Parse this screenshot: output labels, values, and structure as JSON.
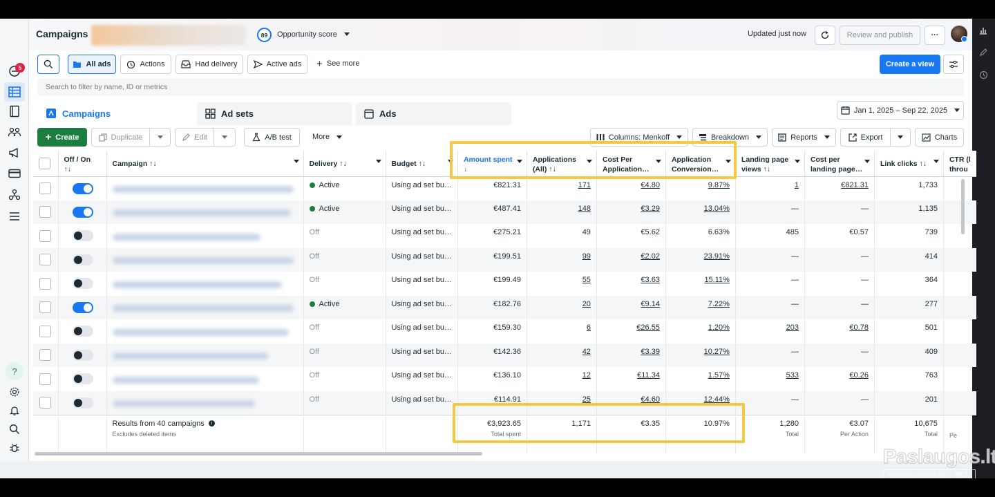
{
  "topbar": {
    "title": "Campaigns",
    "opportunity_score": "89",
    "opportunity_label": "Opportunity score",
    "updated": "Updated just now",
    "review_publish": "Review and publish",
    "more": "···"
  },
  "left_rail": {
    "notification_count": "5"
  },
  "filters": {
    "all_ads": "All ads",
    "actions": "Actions",
    "had_delivery": "Had delivery",
    "active_ads": "Active ads",
    "see_more": "See more",
    "create_view": "Create a view",
    "search_placeholder": "Search to filter by name, ID or metrics"
  },
  "tabs": {
    "campaigns": "Campaigns",
    "ad_sets": "Ad sets",
    "ads": "Ads"
  },
  "date_range": "Jan 1, 2025 – Sep 22, 2025",
  "toolbar": {
    "create": "Create",
    "duplicate": "Duplicate",
    "edit": "Edit",
    "ab_test": "A/B test",
    "more": "More",
    "columns": "Columns: Menkoff",
    "breakdown": "Breakdown",
    "reports": "Reports",
    "export": "Export",
    "charts": "Charts"
  },
  "table": {
    "headers": {
      "offon": [
        "Off / On",
        "↑↓"
      ],
      "campaign": "Campaign ↑↓",
      "delivery": "Delivery ↑↓",
      "budget": "Budget ↑↓",
      "amount_spent": [
        "Amount spent",
        "↓"
      ],
      "applications": [
        "Applications",
        "(All) ↑↓"
      ],
      "cost_per_app": [
        "Cost Per",
        "Application…"
      ],
      "app_conv": [
        "Application",
        "Conversion…"
      ],
      "lp_views": [
        "Landing page",
        "views ↑↓"
      ],
      "cost_lp": [
        "Cost per",
        "landing page…"
      ],
      "link_clicks": "Link clicks ↑↓",
      "ctr": [
        "CTR (l",
        "throu"
      ]
    },
    "rows": [
      {
        "on": true,
        "delivery": "Active",
        "budget": "Using ad set bu…",
        "spent": "€821.31",
        "apps": "171",
        "cpa": "€4.80",
        "conv": "9.87%",
        "lpv": "1",
        "cplp": "€821.31",
        "clicks": "1,733"
      },
      {
        "on": true,
        "delivery": "Active",
        "budget": "Using ad set bu…",
        "spent": "€487.41",
        "apps": "148",
        "cpa": "€3.29",
        "conv": "13.04%",
        "lpv": "—",
        "cplp": "—",
        "clicks": "1,135"
      },
      {
        "on": false,
        "delivery": "Off",
        "budget": "Using ad set bu…",
        "spent": "€275.21",
        "apps": "49",
        "cpa": "€5.62",
        "conv": "6.63%",
        "lpv": "485",
        "cplp": "€0.57",
        "clicks": "739"
      },
      {
        "on": false,
        "delivery": "Off",
        "budget": "Using ad set bu…",
        "spent": "€199.51",
        "apps": "99",
        "cpa": "€2.02",
        "conv": "23.91%",
        "lpv": "—",
        "cplp": "—",
        "clicks": "414"
      },
      {
        "on": false,
        "delivery": "Off",
        "budget": "Using ad set bu…",
        "spent": "€199.49",
        "apps": "55",
        "cpa": "€3.63",
        "conv": "15.11%",
        "lpv": "—",
        "cplp": "—",
        "clicks": "364"
      },
      {
        "on": true,
        "delivery": "Active",
        "budget": "Using ad set bu…",
        "spent": "€182.76",
        "apps": "20",
        "cpa": "€9.14",
        "conv": "7.22%",
        "lpv": "—",
        "cplp": "—",
        "clicks": "277"
      },
      {
        "on": false,
        "delivery": "Off",
        "budget": "Using ad set bu…",
        "spent": "€159.30",
        "apps": "6",
        "cpa": "€26.55",
        "conv": "1.20%",
        "lpv": "203",
        "cplp": "€0.78",
        "clicks": "501"
      },
      {
        "on": false,
        "delivery": "Off",
        "budget": "Using ad set bu…",
        "spent": "€142.36",
        "apps": "42",
        "cpa": "€3.39",
        "conv": "10.27%",
        "lpv": "—",
        "cplp": "—",
        "clicks": "409"
      },
      {
        "on": false,
        "delivery": "Off",
        "budget": "Using ad set bu…",
        "spent": "€136.10",
        "apps": "12",
        "cpa": "€11.34",
        "conv": "1.57%",
        "lpv": "533",
        "cplp": "€0.26",
        "clicks": "763"
      },
      {
        "on": false,
        "delivery": "Off",
        "budget": "Using ad set bu…",
        "spent": "€114.91",
        "apps": "25",
        "cpa": "€4.60",
        "conv": "12.44%",
        "lpv": "—",
        "cplp": "—",
        "clicks": "201"
      }
    ],
    "totals": {
      "results": "Results from 40 campaigns",
      "excludes": "Excludes deleted items",
      "spent": "€3,923.65",
      "spent_sub": "Total spent",
      "apps": "1,171",
      "cpa": "€3.35",
      "conv": "10.97%",
      "lpv": "1,280",
      "lpv_sub": "Total",
      "cplp": "€3.07",
      "cplp_sub": "Per Action",
      "clicks": "10,675",
      "clicks_sub": "Total",
      "ctr_sub": "Pe"
    }
  },
  "watermark": {
    "name": "Paslaugos.lt",
    "tagline": "PASLAUGŲ PORTALAS",
    "rank": "Nr.1"
  },
  "colors": {
    "accent": "#1877f2",
    "highlight": "#f5c844",
    "create": "#1b7d3f",
    "active": "#1b7d3f"
  }
}
